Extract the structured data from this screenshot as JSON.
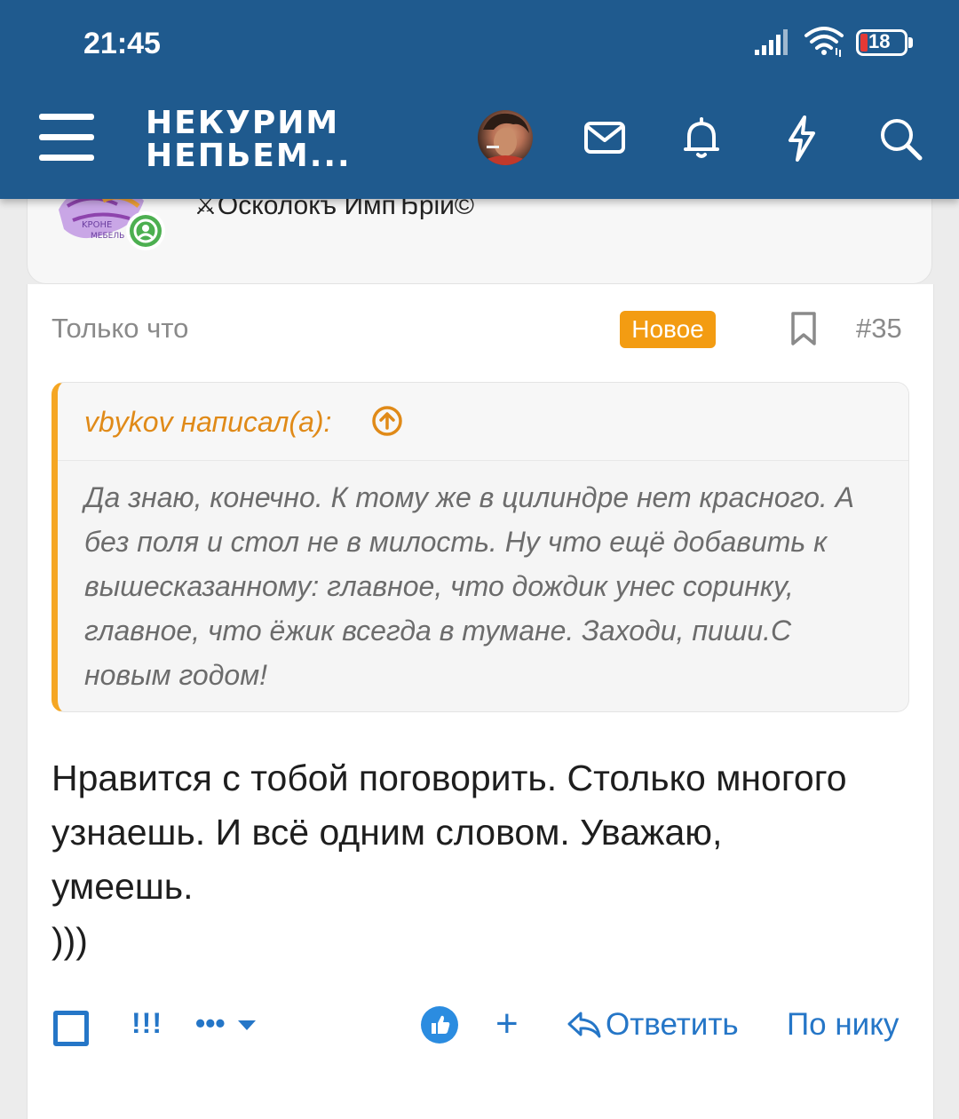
{
  "status_bar": {
    "time": "21:45",
    "battery": "18"
  },
  "header": {
    "logo_line1": "НЕКУРИМ",
    "logo_line2": "НЕПЬЕМ..."
  },
  "author": {
    "name": "⚔Осколокъ ИмпЂрiи©"
  },
  "post": {
    "time": "Только что",
    "new_badge": "Новое",
    "number": "#35",
    "quote": {
      "author": "vbykov написал(а):",
      "text": "Да знаю, конечно. К тому же в цилиндре нет красного. А без поля и стол не в милость. Ну что ещё добавить к вышесказанному: главное, что дождик унес соринку, главное, что ёжик всегда в тумане. Заходи, пиши.С новым годом!"
    },
    "body": "Нравится с тобой поговорить. Столько многого узнаешь. И всё одним словом. Уважаю, умеешь.\n)))"
  },
  "actions": {
    "exclaim": "!!!",
    "more": "•••",
    "plus": "+",
    "reply": "Ответить",
    "quote_nick": "По нику"
  },
  "colors": {
    "header_bg": "#1f5a8e",
    "accent_orange": "#f39c12",
    "link_blue": "#2576c7",
    "online_green": "#4caf50"
  }
}
